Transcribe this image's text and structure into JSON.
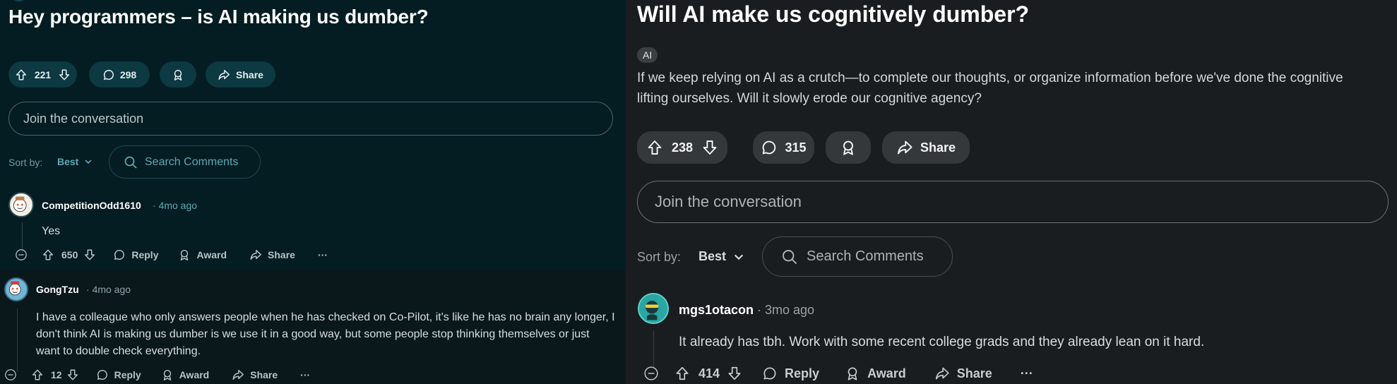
{
  "left_post": {
    "title": "Hey programmers – is AI making us dumber?",
    "votes": "221",
    "comment_count": "298",
    "share_label": "Share",
    "join_placeholder": "Join the conversation",
    "sort_label": "Sort by:",
    "sort_value": "Best",
    "search_placeholder": "Search Comments",
    "comments": [
      {
        "username": "CompetitionOdd1610",
        "time": "4mo ago",
        "text": "Yes",
        "votes": "650",
        "reply_label": "Reply",
        "award_label": "Award",
        "share_label": "Share",
        "more_label": "···"
      },
      {
        "username": "GongTzu",
        "time": "4mo ago",
        "text": "I have a colleague who only answers people when he has checked on Co-Pilot, it's like he has no brain any longer, I don't think AI is making us dumber is we use it in a good way, but some people stop thinking themselves or just want to double check everything.",
        "votes": "12",
        "reply_label": "Reply",
        "award_label": "Award",
        "share_label": "Share",
        "more_label": "···"
      }
    ]
  },
  "right_post": {
    "title": "Will AI make us cognitively dumber?",
    "flair": "AI",
    "body": "If we keep relying on AI as a crutch—to complete our thoughts, or organize information before we've done the cognitive lifting ourselves. Will it slowly erode our cognitive agency?",
    "votes": "238",
    "comment_count": "315",
    "share_label": "Share",
    "join_placeholder": "Join the conversation",
    "sort_label": "Sort by:",
    "sort_value": "Best",
    "search_placeholder": "Search Comments",
    "comments": [
      {
        "username": "mgs1otacon",
        "time": "3mo ago",
        "text": "It already has tbh. Work with some recent college grads and they already lean on it hard.",
        "votes": "414",
        "reply_label": "Reply",
        "award_label": "Award",
        "share_label": "Share",
        "more_label": "···"
      }
    ]
  },
  "separator": "·"
}
